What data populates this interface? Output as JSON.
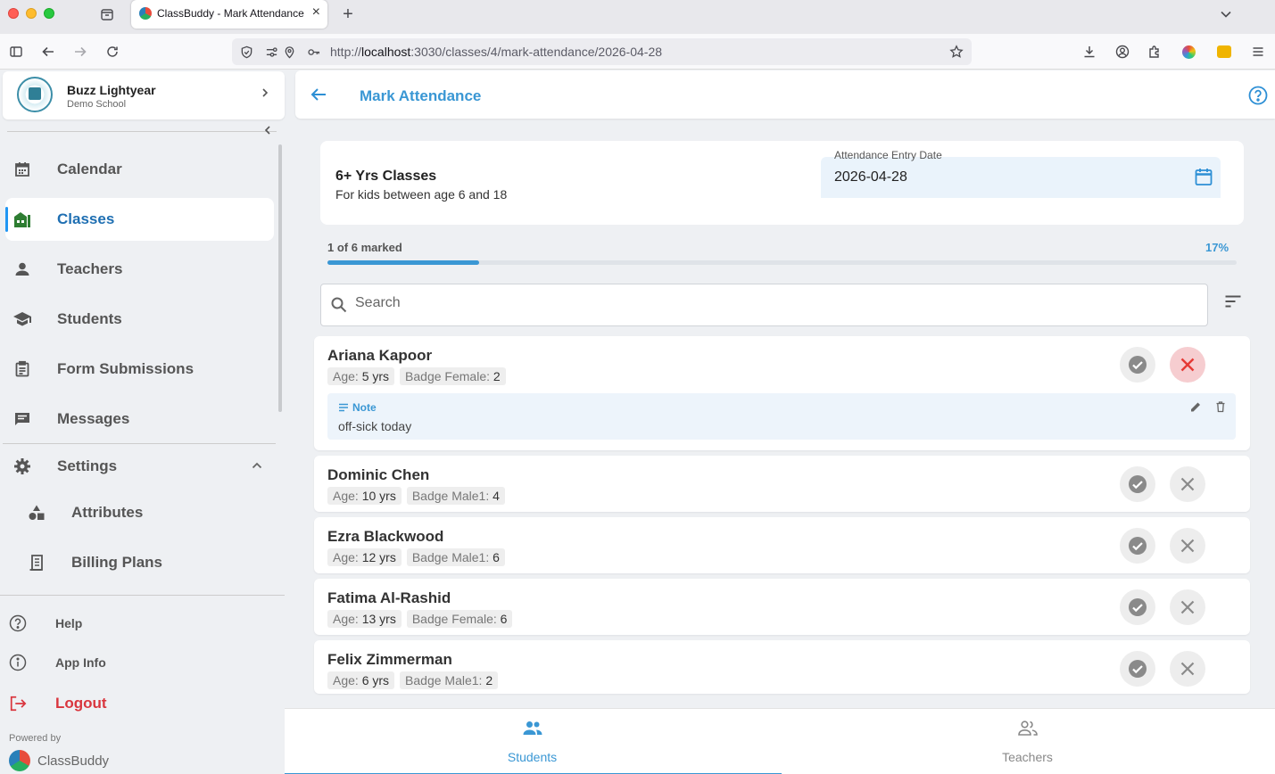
{
  "browser": {
    "tab_title": "ClassBuddy - Mark Attendance",
    "url_prefix": "http://",
    "url_host": "localhost",
    "url_path": ":3030/classes/4/mark-attendance/2026-04-28"
  },
  "sidebar": {
    "user_name": "Buzz Lightyear",
    "school_name": "Demo School",
    "items": [
      {
        "label": "Calendar",
        "icon": "calendar-icon"
      },
      {
        "label": "Classes",
        "icon": "classes-icon",
        "active": true
      },
      {
        "label": "Teachers",
        "icon": "person-icon"
      },
      {
        "label": "Students",
        "icon": "school-icon"
      },
      {
        "label": "Form Submissions",
        "icon": "form-icon"
      },
      {
        "label": "Messages",
        "icon": "message-icon"
      },
      {
        "label": "Settings",
        "icon": "gear-icon"
      }
    ],
    "sub_items": [
      {
        "label": "Attributes",
        "icon": "shapes-icon"
      },
      {
        "label": "Billing Plans",
        "icon": "receipt-icon"
      }
    ],
    "help_label": "Help",
    "appinfo_label": "App Info",
    "logout_label": "Logout",
    "powered_by": "Powered by",
    "brand": "ClassBuddy"
  },
  "header": {
    "title": "Mark Attendance"
  },
  "class_info": {
    "name": "6+ Yrs Classes",
    "description": "For kids between age 6 and 18",
    "date_label": "Attendance Entry Date",
    "date_value": "2026-04-28"
  },
  "progress": {
    "marked_text": "1 of 6 marked",
    "percent_text": "17%",
    "fraction": 0.167
  },
  "search": {
    "placeholder": "Search"
  },
  "students": [
    {
      "name": "Ariana Kapoor",
      "age_label": "Age:",
      "age_value": "5 yrs",
      "badge_label": "Badge Female:",
      "badge_value": "2",
      "status": "absent",
      "note_label": "Note",
      "note_text": "off-sick today"
    },
    {
      "name": "Dominic Chen",
      "age_label": "Age:",
      "age_value": "10 yrs",
      "badge_label": "Badge Male1:",
      "badge_value": "4",
      "status": "unmarked"
    },
    {
      "name": "Ezra Blackwood",
      "age_label": "Age:",
      "age_value": "12 yrs",
      "badge_label": "Badge Male1:",
      "badge_value": "6",
      "status": "unmarked"
    },
    {
      "name": "Fatima Al-Rashid",
      "age_label": "Age:",
      "age_value": "13 yrs",
      "badge_label": "Badge Female:",
      "badge_value": "6",
      "status": "unmarked"
    },
    {
      "name": "Felix Zimmerman",
      "age_label": "Age:",
      "age_value": "6 yrs",
      "badge_label": "Badge Male1:",
      "badge_value": "2",
      "status": "unmarked"
    }
  ],
  "bottom_tabs": [
    {
      "label": "Students",
      "active": true
    },
    {
      "label": "Teachers",
      "active": false
    }
  ],
  "colors": {
    "accent": "#3a97d4",
    "absent": "#e53935",
    "active_nav": "#1f6fb2"
  }
}
